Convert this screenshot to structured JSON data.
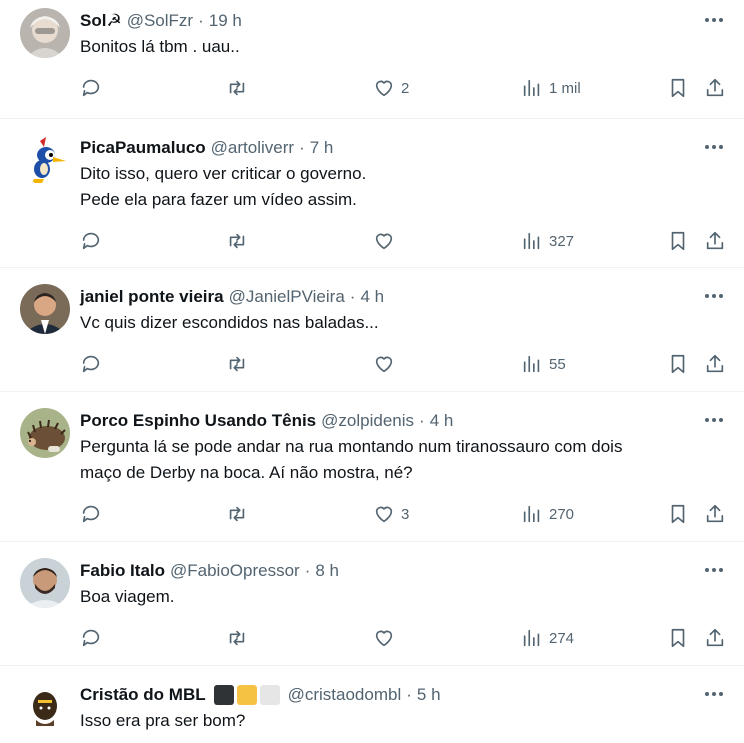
{
  "tweets": [
    {
      "name": "Sol☭",
      "handle": "@SolFzr",
      "time": "19 h",
      "text": "Bonitos lá tbm . uau..",
      "likes": "2",
      "views": "1 mil",
      "avatar": "person-white-hair-icon"
    },
    {
      "name": "PicaPaumaluco",
      "handle": "@artoliverr",
      "time": "7 h",
      "text": "Dito isso, quero ver criticar o governo.\nPede ela para fazer um vídeo assim.",
      "likes": "",
      "views": "327",
      "avatar": "woodpecker-icon"
    },
    {
      "name": "janiel ponte vieira",
      "handle": "@JanielPVieira",
      "time": "4 h",
      "text": "Vc quis dizer escondidos nas baladas...",
      "likes": "",
      "views": "55",
      "avatar": "person-suit-icon"
    },
    {
      "name": "Porco Espinho Usando Tênis",
      "handle": "@zolpidenis",
      "time": "4 h",
      "text": "Pergunta lá se pode andar na rua montando num tiranossauro com dois\nmaço de Derby na boca. Aí não mostra, né?",
      "likes": "3",
      "views": "270",
      "avatar": "hedgehog-icon"
    },
    {
      "name": "Fabio Italo",
      "handle": "@FabioOpressor",
      "time": "8 h",
      "text": "Boa viagem.",
      "likes": "",
      "views": "274",
      "avatar": "person-beard-icon"
    },
    {
      "name": "Cristão do MBL",
      "handle": "@cristaodombl",
      "time": "5 h",
      "text": "Isso era pra ser bom?",
      "likes": "",
      "views": "",
      "avatar": "figure-icon",
      "badges": [
        "#2f3336",
        "#f6c244",
        "#e6e6e6"
      ]
    }
  ],
  "separator": "·"
}
